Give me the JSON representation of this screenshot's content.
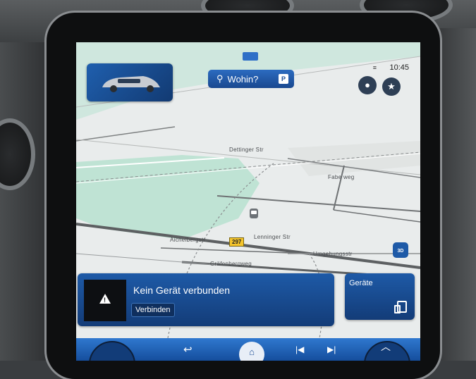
{
  "header": {
    "search_label": "Wohin?",
    "parking_badge": "P",
    "time": "10:45",
    "signal_icon": "signal-icon",
    "profile_icon": "profile-icon",
    "favorites_icon": "star-icon"
  },
  "map": {
    "streets": [
      "Dettinger Str",
      "Fabe weg",
      "Aichelbergstr",
      "Lenninger Str",
      "Umgehungsstr",
      "Gräfenbergweg"
    ],
    "road_number": "297",
    "view_mode": "3D"
  },
  "notification": {
    "title": "Kein Gerät verbunden",
    "connect_label": "Verbinden",
    "icon": "warning-icon"
  },
  "devices": {
    "label": "Geräte",
    "icon": "phone-devices-icon"
  },
  "colors": {
    "accent_blue": "#1e5aa7",
    "map_green": "#bfe3d4",
    "road_badge": "#f5c52b"
  }
}
